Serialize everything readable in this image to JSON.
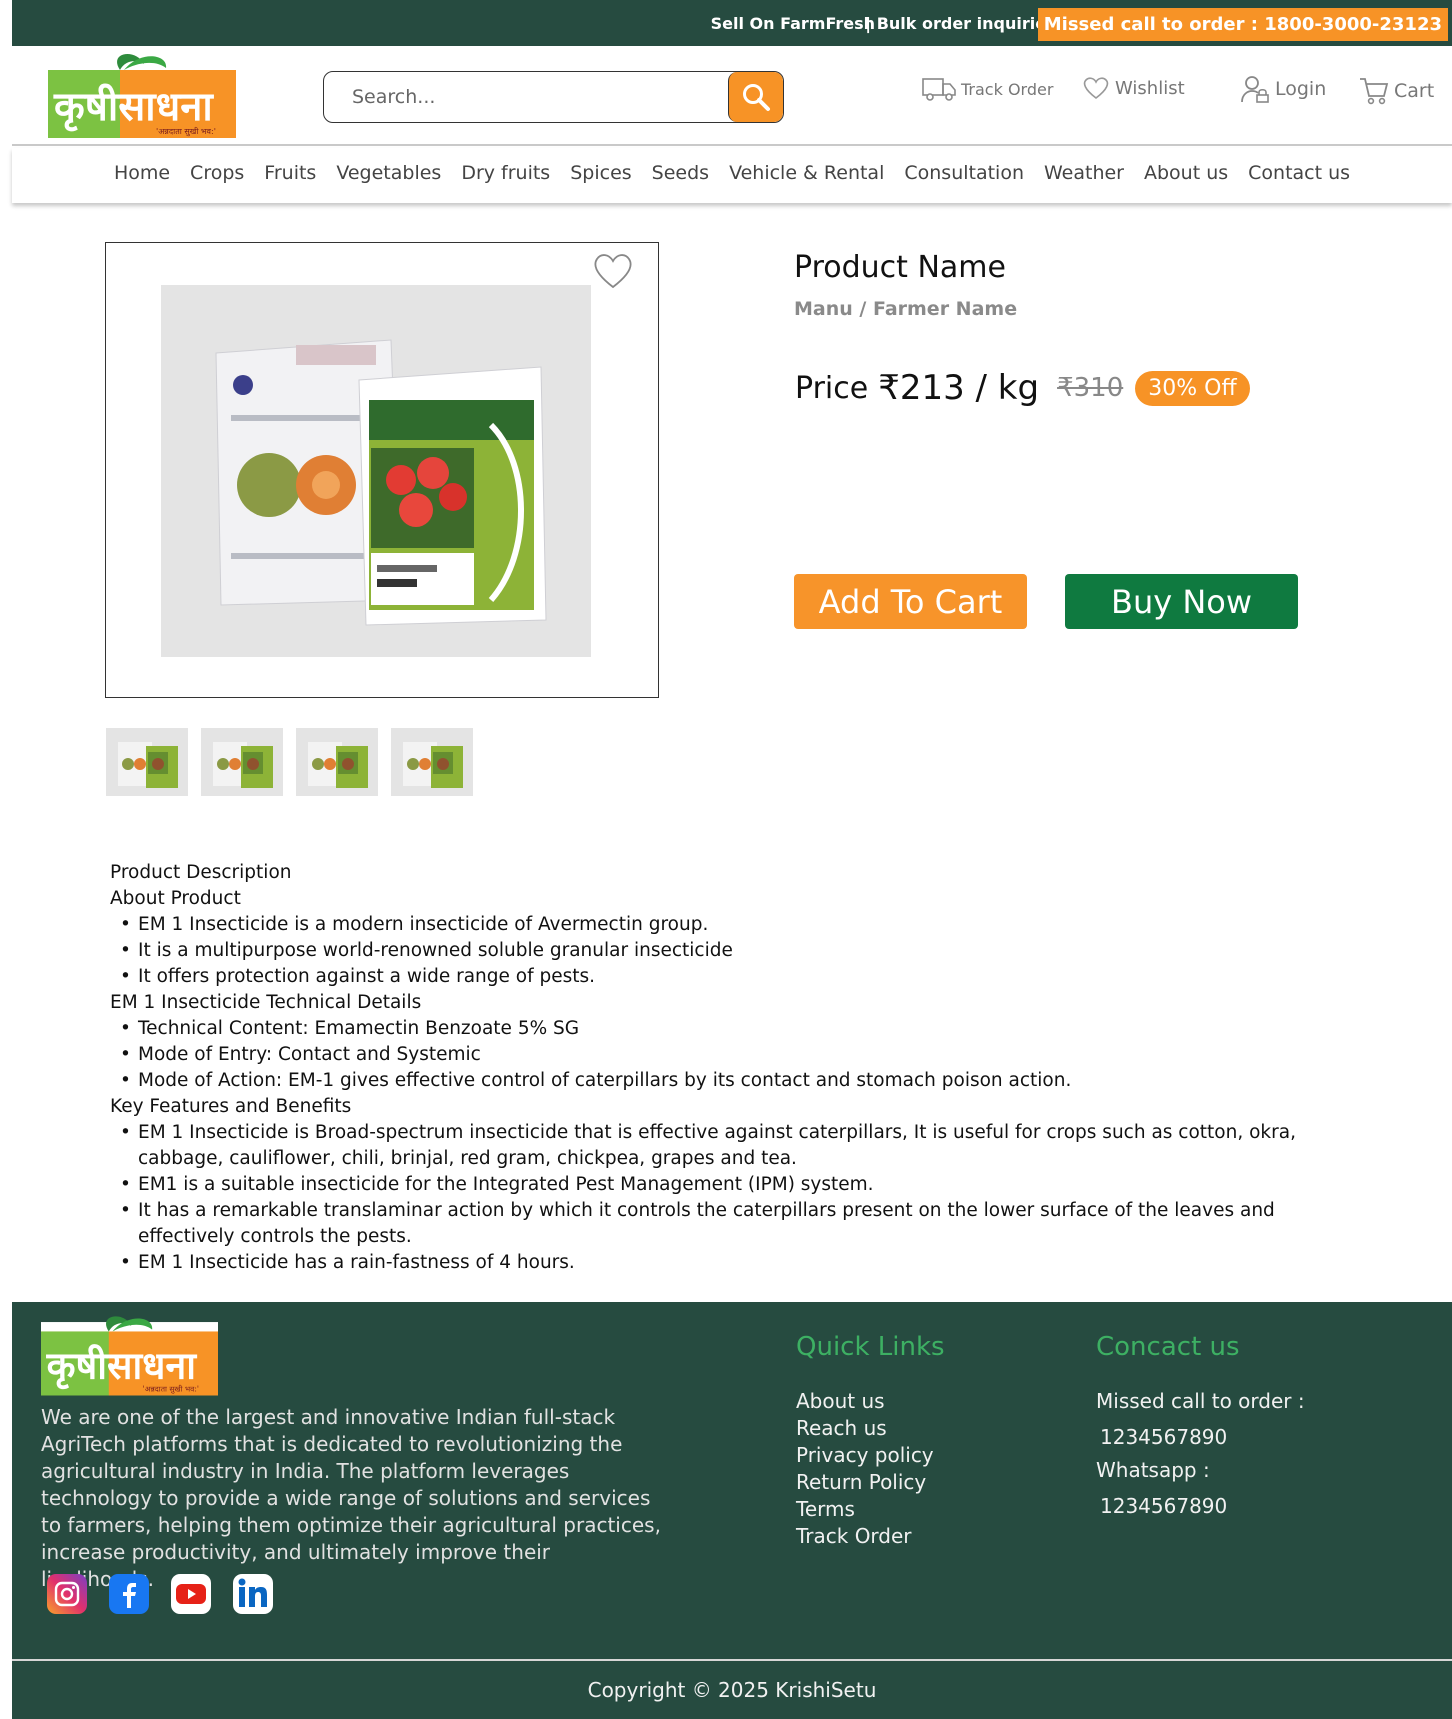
{
  "topbar": {
    "sell": "Sell On FarmFresh",
    "bulk": "| Bulk order inquiries |",
    "missed_call": "Missed call to order : 1800-3000-23123"
  },
  "brand": {
    "logo_text": "कृषीसाधना",
    "tagline": "'अन्नदाता सुखी भव:'"
  },
  "search": {
    "placeholder": "Search..."
  },
  "header_links": {
    "track": "Track Order",
    "wishlist": "Wishlist",
    "login": "Login",
    "cart": "Cart"
  },
  "menu": [
    "Home",
    "Crops",
    "Fruits",
    "Vegetables",
    "Dry fruits",
    "Spices",
    "Seeds",
    "Vehicle & Rental",
    "Consultation",
    "Weather",
    "About us",
    "Contact us"
  ],
  "product": {
    "name": "Product Name",
    "seller": "Manu / Farmer Name",
    "price_label": "Price",
    "price": "₹213 / kg",
    "mrp": "₹310",
    "discount": "30% Off",
    "add_to_cart": "Add To Cart",
    "buy_now": "Buy Now"
  },
  "description": {
    "heading": "Product Description",
    "about_heading": "About Product",
    "about": [
      "EM 1 Insecticide is a modern insecticide of Avermectin group.",
      "It is a multipurpose world-renowned soluble granular insecticide",
      "It offers protection against a wide range of pests."
    ],
    "tech_heading": "EM 1 Insecticide Technical Details",
    "tech": [
      "Technical Content: Emamectin Benzoate 5% SG",
      "Mode of Entry: Contact and Systemic",
      "Mode of Action: EM-1 gives effective control of caterpillars by its contact and stomach poison action."
    ],
    "features_heading": "Key Features and Benefits",
    "features": [
      "EM 1 Insecticide is Broad-spectrum insecticide that is effective against caterpillars, It is useful for crops such as cotton, okra, cabbage, cauliflower, chili, brinjal, red gram, chickpea, grapes and tea.",
      "EM1 is a suitable insecticide for the Integrated Pest Management (IPM) system.",
      "It has a remarkable translaminar action by which it controls the caterpillars present on the lower surface of the leaves and effectively controls the pests.",
      "EM 1 Insecticide has a rain-fastness of 4 hours."
    ]
  },
  "footer": {
    "about": "We are one of the largest and innovative Indian full-stack AgriTech platforms that is dedicated to revolutionizing the agricultural industry in India. The platform leverages technology to provide a wide range of solutions and services to farmers, helping them optimize their agricultural practices, increase productivity, and ultimately improve their livelihoods.",
    "quick_links_heading": "Quick Links",
    "quick_links": [
      "About us",
      "Reach us",
      "Privacy policy",
      "Return Policy",
      "Terms",
      "Track Order"
    ],
    "contact_heading": "Concact us",
    "missed_call_label": "Missed call to order :",
    "missed_call_number": "1234567890",
    "whatsapp_label": "Whatsapp :",
    "whatsapp_number": "1234567890",
    "copyright": "Copyright © 2025 KrishiSetu"
  },
  "social_icons": [
    "instagram-icon",
    "facebook-icon",
    "youtube-icon",
    "linkedin-icon"
  ],
  "colors": {
    "header_green": "#264b40",
    "accent_orange": "#f79326",
    "buy_green": "#0f7a40",
    "footer_heading": "#3db063"
  }
}
